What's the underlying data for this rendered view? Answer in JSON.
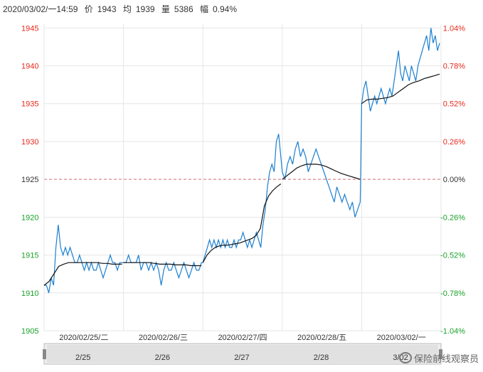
{
  "header": {
    "datetime": "2020/03/02/一14:59",
    "price_label": "价",
    "price": "1943",
    "avg_label": "均",
    "avg": "1939",
    "vol_label": "量",
    "vol": "5386",
    "chg_label": "幅",
    "chg": "0.94%"
  },
  "watermark": "保险前线观察员",
  "colors": {
    "up": "#e8291c",
    "down": "#1aa12a",
    "neutral": "#333333",
    "price_line": "#1b7fd0",
    "avg_line": "#111111",
    "ref_line": "#d66a6a"
  },
  "chart_data": {
    "type": "line",
    "y_ticks": [
      1945,
      1940,
      1935,
      1930,
      1925,
      1920,
      1915,
      1910,
      1905
    ],
    "pct_ticks": [
      "1.04%",
      "0.78%",
      "0.52%",
      "0.26%",
      "0.00%",
      "-0.26%",
      "-0.52%",
      "-0.78%",
      "-1.04%"
    ],
    "ylim": [
      1905,
      1945.5
    ],
    "reference": 1925,
    "x_labels": [
      "2020/02/25/二",
      "2020/02/26/三",
      "2020/02/27/四",
      "2020/02/28/五",
      "2020/03/02/一"
    ],
    "navigator_labels": [
      "2/25",
      "2/26",
      "2/27",
      "2/28",
      "3/02"
    ],
    "days": [
      {
        "price": [
          1911,
          1911,
          1910,
          1912,
          1911,
          1916,
          1919,
          1916,
          1915,
          1916,
          1915,
          1916,
          1915,
          1914,
          1914,
          1915,
          1914,
          1913,
          1914,
          1913,
          1914,
          1913,
          1913,
          1914,
          1913,
          1912,
          1913,
          1914,
          1915,
          1914,
          1914,
          1913,
          1914,
          1914
        ],
        "avg": [
          1911,
          1911.5,
          1912.5,
          1913.5,
          1913.8,
          1914,
          1914,
          1914,
          1914,
          1914,
          1914,
          1914,
          1913.9,
          1913.9,
          1913.8,
          1913.8,
          1913.8
        ]
      },
      {
        "price": [
          1914,
          1914,
          1915,
          1914,
          1914,
          1914,
          1915,
          1913,
          1914,
          1914,
          1913,
          1914,
          1913,
          1914,
          1913,
          1911,
          1913,
          1914,
          1913,
          1913,
          1914,
          1913,
          1912,
          1913,
          1914,
          1913,
          1912,
          1913,
          1914,
          1913,
          1913,
          1914
        ],
        "avg": [
          1914,
          1914,
          1914,
          1914,
          1914,
          1914,
          1913.9,
          1913.8,
          1913.8,
          1913.8,
          1913.7,
          1913.7,
          1913.7,
          1913.6,
          1913.6,
          1913.6
        ]
      },
      {
        "price": [
          1914,
          1915,
          1916,
          1917,
          1916,
          1917,
          1916,
          1917,
          1916,
          1917,
          1916,
          1917,
          1916,
          1916,
          1917,
          1916,
          1917,
          1917,
          1918,
          1917,
          1916,
          1917,
          1916,
          1917,
          1918,
          1917,
          1916,
          1919,
          1921,
          1924,
          1926,
          1927,
          1926,
          1930,
          1931,
          1928
        ],
        "avg": [
          1914,
          1915,
          1915.6,
          1916,
          1916.2,
          1916.3,
          1916.3,
          1916.4,
          1916.5,
          1916.6,
          1916.8,
          1917,
          1917.2,
          1917.6,
          1918.5,
          1921.5,
          1922.8,
          1923.5,
          1924,
          1924.4
        ]
      },
      {
        "price": [
          1926,
          1925,
          1927,
          1928,
          1927,
          1929,
          1930,
          1928,
          1929,
          1928,
          1926,
          1927,
          1928,
          1929,
          1928,
          1927,
          1926,
          1925,
          1924,
          1923,
          1922,
          1924,
          1923,
          1922,
          1923,
          1922,
          1921,
          1922,
          1920,
          1921,
          1922
        ],
        "avg": [
          1925,
          1925.5,
          1926,
          1926.5,
          1926.8,
          1927,
          1927,
          1927,
          1926.9,
          1926.7,
          1926.4,
          1926.1,
          1925.8,
          1925.6,
          1925.4,
          1925.2,
          1925
        ]
      },
      {
        "price": [
          1935,
          1937,
          1938,
          1936,
          1934,
          1935,
          1936,
          1935,
          1936,
          1937,
          1936,
          1935,
          1936,
          1937,
          1936,
          1938,
          1940,
          1942,
          1939,
          1938,
          1940,
          1939,
          1938,
          1940,
          1939,
          1938,
          1940,
          1941,
          1942,
          1943,
          1944,
          1942,
          1945,
          1943,
          1944,
          1942,
          1943
        ],
        "avg": [
          1935,
          1935.5,
          1935.6,
          1935.6,
          1935.7,
          1935.8,
          1936,
          1936.5,
          1937,
          1937.5,
          1937.8,
          1938,
          1938.3,
          1938.5,
          1938.7,
          1938.9
        ]
      }
    ]
  }
}
